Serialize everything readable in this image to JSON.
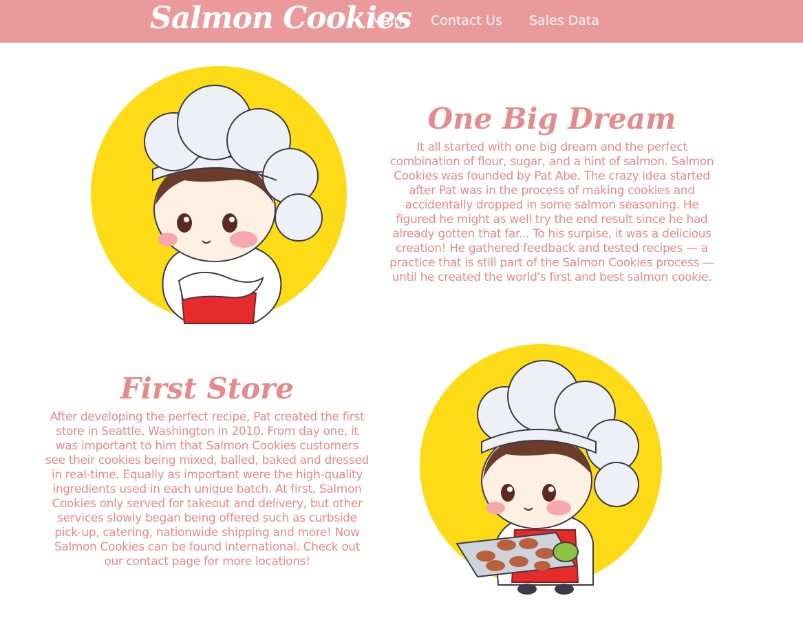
{
  "header": {
    "brand": "Salmon Cookies",
    "nav": [
      {
        "label": "Main"
      },
      {
        "label": "Contact Us"
      },
      {
        "label": "Sales Data"
      }
    ]
  },
  "sections": [
    {
      "title": "One Big Dream",
      "text": "It all started with one big dream and the perfect combination of flour, sugar, and a hint of salmon. Salmon Cookies was founded by Pat Abe. The crazy idea started after Pat was in the process of making cookies and accidentally dropped in some salmon seasoning. He figured he might as well try the end result since he had already gotten that far... To his surpise, it was a delicious creation! He gathered feedback and tested recipes — a practice that is still part of the Salmon Cookies process — until he created the world's first and best salmon cookie.",
      "image_icon": "chef-arms-crossed-icon"
    },
    {
      "title": "First Store",
      "text": "After developing the perfect recipe, Pat created the first store in Seattle, Washington in 2010. From day one, it was important to him that Salmon Cookies customers see their cookies being mixed, balled, baked and dressed in real-time. Equally as important were the high-quality ingredients used in each unique batch. At first, Salmon Cookies only served for takeout and delivery, but other services slowly began being offered such as curbside pick-up, catering, nationwide shipping and more! Now Salmon Cookies can be found international. Check out our contact page for more locations!",
      "image_icon": "chef-cookie-tray-icon"
    }
  ],
  "colors": {
    "navbar": "#ea9a9a",
    "accent_text": "#e48b8b",
    "circle": "#fddb16"
  }
}
